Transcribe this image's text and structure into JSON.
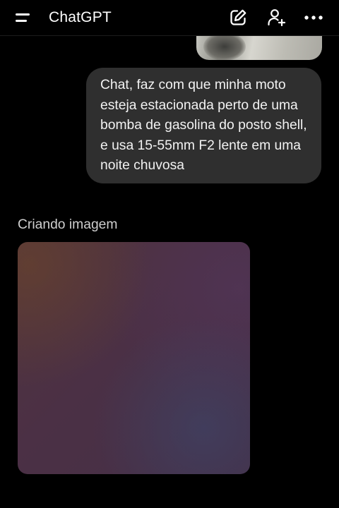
{
  "header": {
    "title": "ChatGPT",
    "icons": [
      "menu-icon",
      "new-chat-icon",
      "add-user-icon",
      "more-icon"
    ]
  },
  "conversation": {
    "user_message": "Chat, faz com que minha moto esteja estacionada perto de uma bomba de gasolina do posto shell, e usa 15-55mm F2 lente em uma noite chuvosa",
    "assistant_status": "Criando imagem"
  },
  "colors": {
    "background": "#000000",
    "bubble": "#2f2f2f",
    "text": "#ffffff",
    "muted_text": "#cfcfcf",
    "placeholder": "#4b3045"
  }
}
